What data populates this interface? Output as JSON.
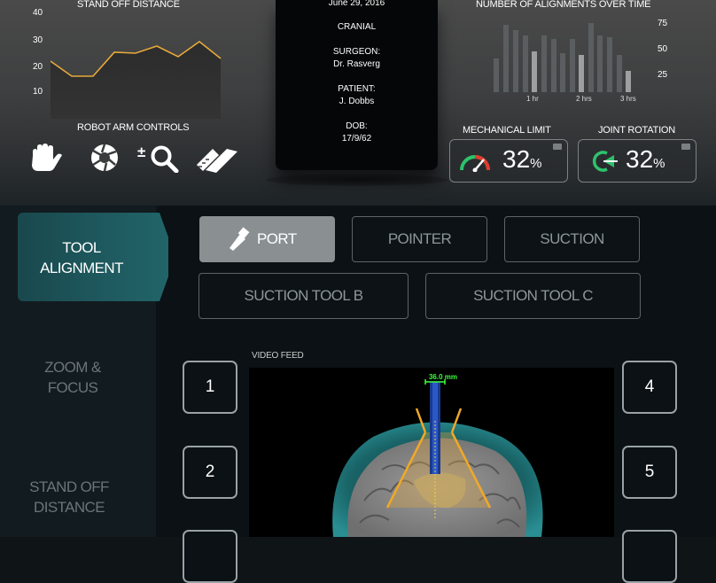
{
  "stand_off": {
    "title": "STAND OFF DISTANCE",
    "y_ticks": [
      "40",
      "30",
      "20",
      "10"
    ]
  },
  "robot": {
    "title": "ROBOT ARM CONTROLS",
    "icons": [
      "hand-icon",
      "aperture-icon",
      "zoom-plus-minus-icon",
      "ruler-pencil-icon"
    ]
  },
  "case": {
    "date": "June 29, 2016",
    "procedure": "CRANIAL",
    "surgeon_label": "SURGEON:",
    "surgeon": "Dr. Rasverg",
    "patient_label": "PATIENT:",
    "patient": "J. Dobbs",
    "dob_label": "DOB:",
    "dob": "17/9/62"
  },
  "alignments": {
    "title": "NUMBER OF ALIGNMENTS OVER TIME",
    "y_ticks": [
      "75",
      "50",
      "25"
    ],
    "x_ticks": [
      "1 hr",
      "2 hrs",
      "3 hrs"
    ]
  },
  "mechanical": {
    "label": "MECHANICAL LIMIT",
    "value": "32",
    "unit": "%"
  },
  "joint": {
    "label": "JOINT ROTATION",
    "value": "32",
    "unit": "%"
  },
  "nav": {
    "tool_alignment_1": "TOOL",
    "tool_alignment_2": "ALIGNMENT",
    "zoom_1": "ZOOM &",
    "zoom_2": "FOCUS",
    "standoff_1": "STAND OFF",
    "standoff_2": "DISTANCE"
  },
  "tools": {
    "port": "PORT",
    "pointer": "POINTER",
    "suction": "SUCTION",
    "suction_b": "SUCTION TOOL B",
    "suction_c": "SUCTION TOOL C"
  },
  "video": {
    "label": "VIDEO FEED",
    "measurement": "36.0 mm"
  },
  "presets": [
    "1",
    "2",
    "4",
    "5"
  ],
  "colors": {
    "accent_teal": "#1e5a5f",
    "line_orange": "#e8a93a",
    "gauge_red": "#e23b2e",
    "gauge_green": "#2ec26b",
    "measure_green": "#3cff3c"
  }
}
